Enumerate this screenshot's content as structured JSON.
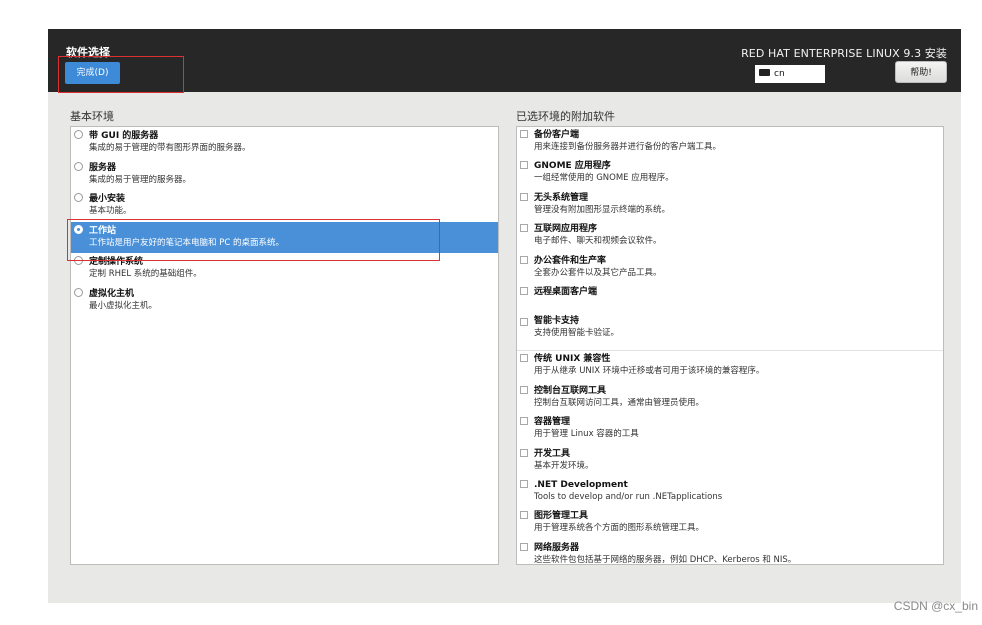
{
  "header": {
    "title": "软件选择",
    "done_label": "完成(D)",
    "product_name": "RED HAT ENTERPRISE LINUX 9.3 安装",
    "keyboard_layout": "cn",
    "help_label": "帮助!"
  },
  "base_env": {
    "heading": "基本环境",
    "items": [
      {
        "name": "带 GUI 的服务器",
        "desc": "集成的易于管理的带有图形界面的服务器。",
        "selected": false
      },
      {
        "name": "服务器",
        "desc": "集成的易于管理的服务器。",
        "selected": false
      },
      {
        "name": "最小安装",
        "desc": "基本功能。",
        "selected": false
      },
      {
        "name": "工作站",
        "desc": "工作站是用户友好的笔记本电脑和 PC 的桌面系统。",
        "selected": true
      },
      {
        "name": "定制操作系统",
        "desc": "定制 RHEL 系统的基础组件。",
        "selected": false
      },
      {
        "name": "虚拟化主机",
        "desc": "最小虚拟化主机。",
        "selected": false
      }
    ]
  },
  "addons": {
    "heading": "已选环境的附加软件",
    "items": [
      {
        "name": "备份客户端",
        "desc": "用来连接到备份服务器并进行备份的客户端工具。"
      },
      {
        "name": "GNOME 应用程序",
        "desc": "一组经常使用的 GNOME 应用程序。"
      },
      {
        "name": "无头系统管理",
        "desc": "管理没有附加图形显示终端的系统。"
      },
      {
        "name": "互联网应用程序",
        "desc": "电子邮件、聊天和视频会议软件。"
      },
      {
        "name": "办公套件和生产率",
        "desc": "全套办公套件以及其它产品工具。"
      },
      {
        "name": "远程桌面客户端",
        "desc": ""
      },
      {
        "name": "智能卡支持",
        "desc": "支持使用智能卡验证。"
      },
      {
        "name": "传统 UNIX 兼容性",
        "desc": "用于从继承 UNIX 环境中迁移或者可用于该环境的兼容程序。"
      },
      {
        "name": "控制台互联网工具",
        "desc": "控制台互联网访问工具，通常由管理员使用。"
      },
      {
        "name": "容器管理",
        "desc": "用于管理 Linux 容器的工具"
      },
      {
        "name": "开发工具",
        "desc": "基本开发环境。"
      },
      {
        "name": ".NET Development",
        "desc": "Tools to develop and/or run .NETapplications"
      },
      {
        "name": "图形管理工具",
        "desc": "用于管理系统各个方面的图形系统管理工具。"
      },
      {
        "name": "网络服务器",
        "desc": "这些软件包包括基于网络的服务器，例如 DHCP、Kerberos 和 NIS。"
      }
    ]
  },
  "watermark": "CSDN @cx_bin",
  "colors": {
    "selected": "#4a90d9",
    "header_bg": "#272727",
    "done_button": "#3d8ad8",
    "annotation": "#dd3030"
  }
}
